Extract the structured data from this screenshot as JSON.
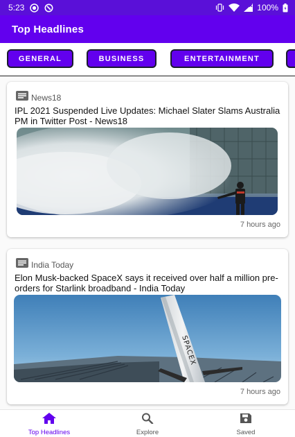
{
  "status_bar": {
    "time": "5:23",
    "battery": "100%",
    "icons": [
      "record-icon",
      "sync-icon",
      "vibrate-icon",
      "wifi-icon",
      "signal-icon",
      "battery-icon"
    ]
  },
  "app_bar": {
    "title": "Top Headlines"
  },
  "categories": [
    {
      "label": "GENERAL"
    },
    {
      "label": "BUSINESS"
    },
    {
      "label": "ENTERTAINMENT"
    },
    {
      "label": ""
    }
  ],
  "articles": [
    {
      "source": "News18",
      "title": "IPL 2021 Suspended Live Updates: Michael Slater Slams Australia PM in Twitter Post - News18",
      "time": "7 hours ago",
      "image": "stadium-fogging-photo"
    },
    {
      "source": "India Today",
      "title": "Elon Musk-backed SpaceX says it received over half a million pre-orders for Starlink broadband - India Today",
      "time": "7 hours ago",
      "image": "spacex-rocket-photo"
    }
  ],
  "bottom_nav": [
    {
      "label": "Top Headlines",
      "icon": "home-icon",
      "active": true
    },
    {
      "label": "Explore",
      "icon": "search-icon",
      "active": false
    },
    {
      "label": "Saved",
      "icon": "save-icon",
      "active": false
    }
  ],
  "colors": {
    "primary": "#6200ee",
    "status_bar": "#5a10d8",
    "chip_border": "#1a1a2e"
  }
}
